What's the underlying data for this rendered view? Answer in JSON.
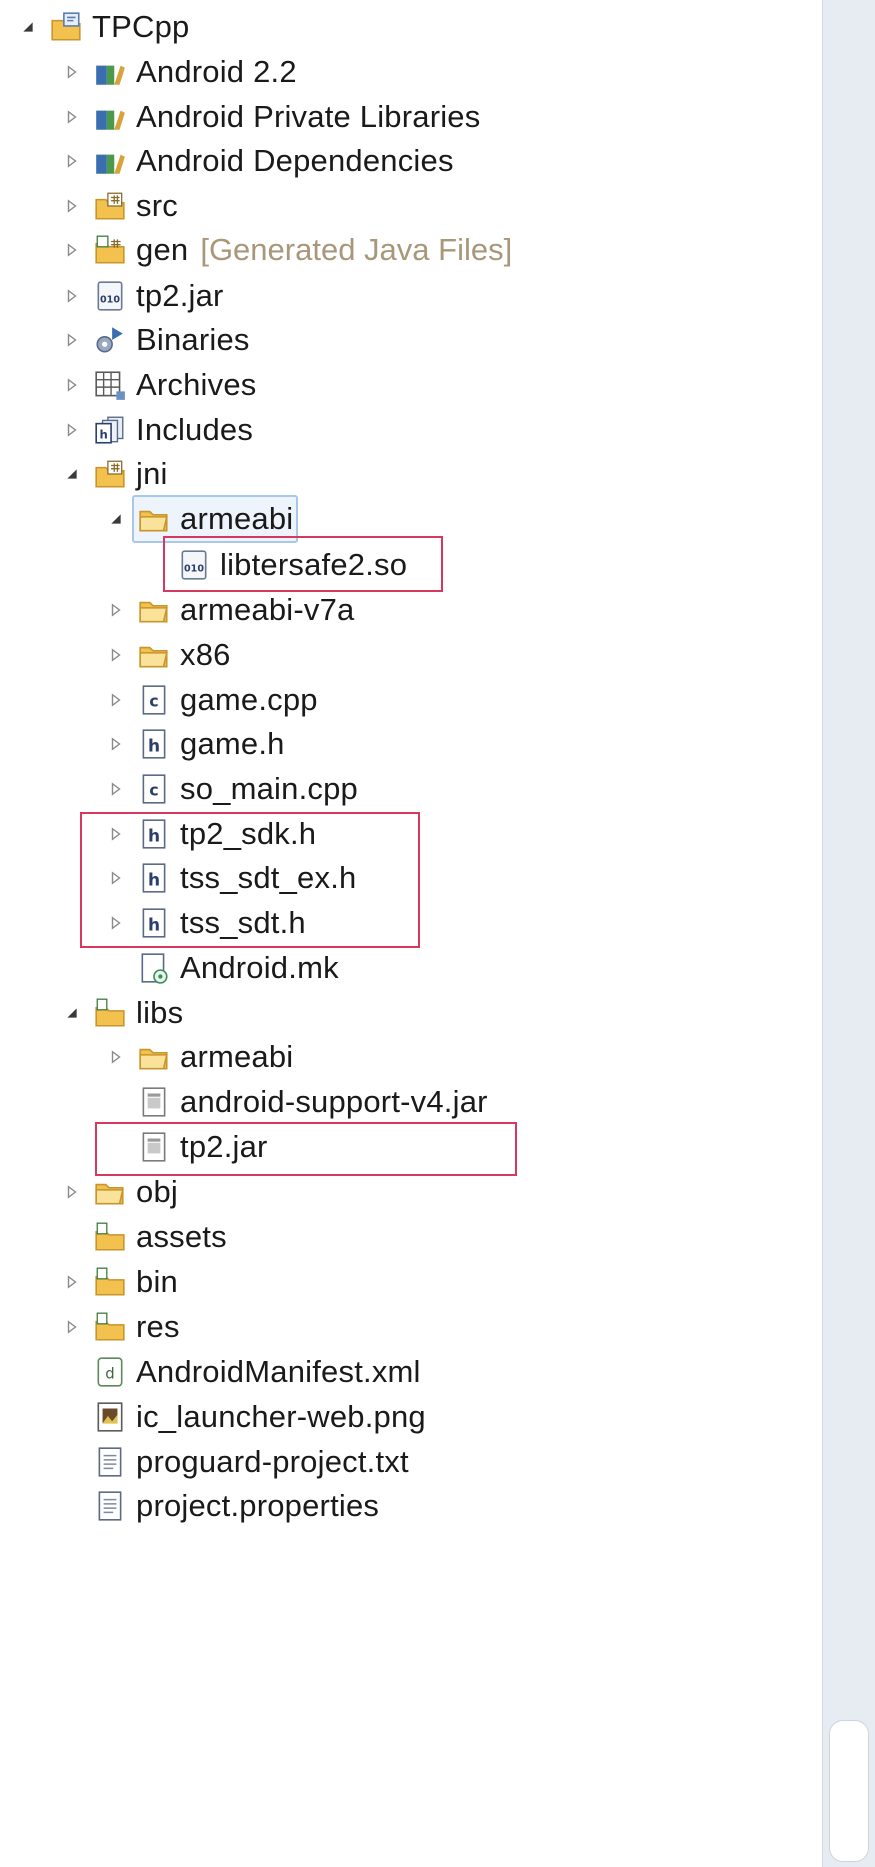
{
  "project": {
    "name": "TPCpp"
  },
  "tree": [
    {
      "label": "TPCpp",
      "icon": "project-icon",
      "arrow": "expanded",
      "depth": 0
    },
    {
      "label": "Android 2.2",
      "icon": "library-icon",
      "arrow": "collapsed",
      "depth": 1
    },
    {
      "label": "Android Private Libraries",
      "icon": "library-icon",
      "arrow": "collapsed",
      "depth": 1
    },
    {
      "label": "Android Dependencies",
      "icon": "library-icon",
      "arrow": "collapsed",
      "depth": 1
    },
    {
      "label": "src",
      "icon": "source-folder-icon",
      "arrow": "collapsed",
      "depth": 1
    },
    {
      "label": "gen",
      "annotation": "[Generated Java Files]",
      "icon": "generated-source-folder-icon",
      "arrow": "collapsed",
      "depth": 1
    },
    {
      "label": "tp2.jar",
      "icon": "binary-file-icon",
      "arrow": "collapsed",
      "depth": 1
    },
    {
      "label": "Binaries",
      "icon": "binaries-icon",
      "arrow": "collapsed",
      "depth": 1
    },
    {
      "label": "Archives",
      "icon": "archives-icon",
      "arrow": "collapsed",
      "depth": 1
    },
    {
      "label": "Includes",
      "icon": "includes-icon",
      "arrow": "collapsed",
      "depth": 1
    },
    {
      "label": "jni",
      "icon": "source-folder-icon",
      "arrow": "expanded",
      "depth": 1
    },
    {
      "label": "armeabi",
      "icon": "folder-icon",
      "arrow": "expanded",
      "depth": 2,
      "selected": true
    },
    {
      "label": "libtersafe2.so",
      "icon": "binary-file-icon",
      "arrow": "none",
      "depth": 3
    },
    {
      "label": "armeabi-v7a",
      "icon": "folder-icon",
      "arrow": "collapsed",
      "depth": 2
    },
    {
      "label": "x86",
      "icon": "folder-icon",
      "arrow": "collapsed",
      "depth": 2
    },
    {
      "label": "game.cpp",
      "icon": "c-file-icon",
      "arrow": "collapsed",
      "depth": 2
    },
    {
      "label": "game.h",
      "icon": "h-file-icon",
      "arrow": "collapsed",
      "depth": 2
    },
    {
      "label": "so_main.cpp",
      "icon": "c-file-icon",
      "arrow": "collapsed",
      "depth": 2
    },
    {
      "label": "tp2_sdk.h",
      "icon": "h-file-icon",
      "arrow": "collapsed",
      "depth": 2
    },
    {
      "label": "tss_sdt_ex.h",
      "icon": "h-file-icon",
      "arrow": "collapsed",
      "depth": 2
    },
    {
      "label": "tss_sdt.h",
      "icon": "h-file-icon",
      "arrow": "collapsed",
      "depth": 2
    },
    {
      "label": "Android.mk",
      "icon": "makefile-icon",
      "arrow": "none",
      "depth": 2
    },
    {
      "label": "libs",
      "icon": "plain-folder-icon",
      "arrow": "expanded",
      "depth": 1
    },
    {
      "label": "armeabi",
      "icon": "folder-icon",
      "arrow": "collapsed",
      "depth": 2
    },
    {
      "label": "android-support-v4.jar",
      "icon": "jar-file-icon",
      "arrow": "none",
      "depth": 2
    },
    {
      "label": "tp2.jar",
      "icon": "jar-file-icon",
      "arrow": "none",
      "depth": 2
    },
    {
      "label": "obj",
      "icon": "folder-icon",
      "arrow": "collapsed",
      "depth": 1
    },
    {
      "label": "assets",
      "icon": "plain-folder-icon",
      "arrow": "none",
      "depth": 1
    },
    {
      "label": "bin",
      "icon": "plain-folder-icon",
      "arrow": "collapsed",
      "depth": 1
    },
    {
      "label": "res",
      "icon": "plain-folder-icon",
      "arrow": "collapsed",
      "depth": 1
    },
    {
      "label": "AndroidManifest.xml",
      "icon": "xml-file-icon",
      "arrow": "none",
      "depth": 1
    },
    {
      "label": "ic_launcher-web.png",
      "icon": "image-file-icon",
      "arrow": "none",
      "depth": 1
    },
    {
      "label": "proguard-project.txt",
      "icon": "text-file-icon",
      "arrow": "none",
      "depth": 1
    },
    {
      "label": "project.properties",
      "icon": "text-file-icon",
      "arrow": "none",
      "depth": 1
    }
  ],
  "colors": {
    "highlight_border": "#d53a5e",
    "selection": "#a9c7e8",
    "annotation_text": "#a8977a"
  }
}
